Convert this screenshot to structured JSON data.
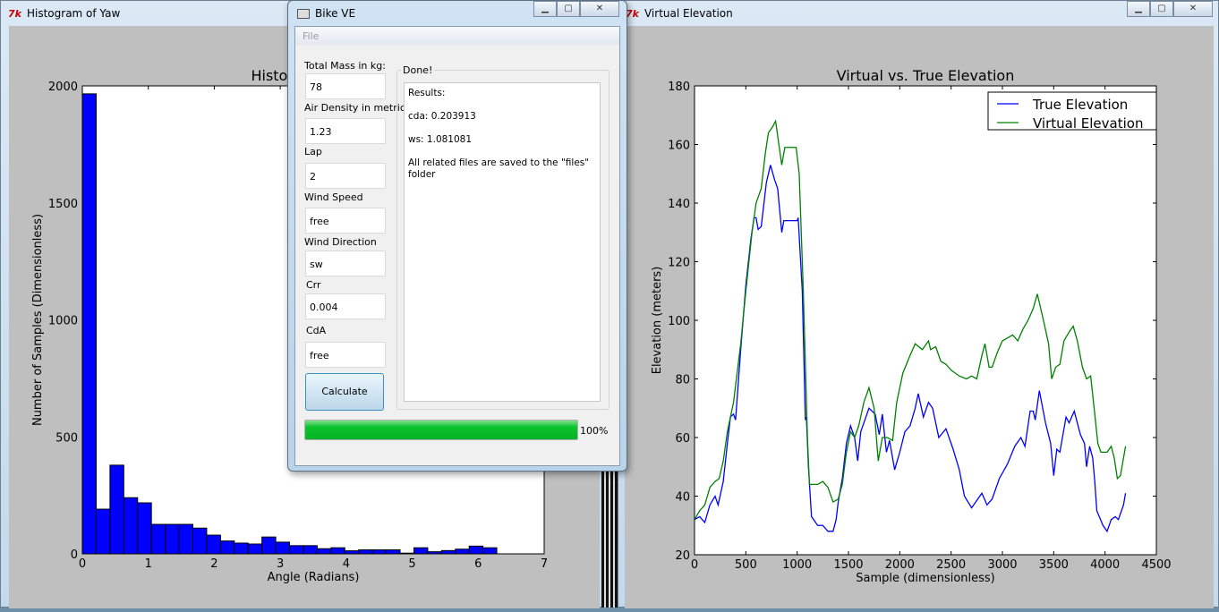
{
  "histogram_window": {
    "title": "Histogram of Yaw"
  },
  "elevation_window": {
    "title": "Virtual Elevation"
  },
  "dialog": {
    "title": "Bike VE",
    "menu_file": "File",
    "fields": [
      {
        "label": "Total Mass in kg:",
        "value": "78"
      },
      {
        "label": "Air Density in metric",
        "value": "1.23"
      },
      {
        "label": "Lap",
        "value": "2"
      },
      {
        "label": "Wind Speed",
        "value": "free"
      },
      {
        "label": "Wind Direction",
        "value": "sw"
      },
      {
        "label": "Crr",
        "value": "0.004"
      },
      {
        "label": "CdA",
        "value": "free"
      }
    ],
    "group_title": "Done!",
    "results": {
      "heading": "Results:",
      "cda": "cda: 0.203913",
      "ws": "ws: 1.081081",
      "note": "All related files are saved to the \"files\" folder"
    },
    "calculate_label": "Calculate",
    "progress": 100,
    "progress_label": "100%",
    "progress_color": "#06b425"
  },
  "chart_data": [
    {
      "type": "bar",
      "title": "Histogram of Yaw",
      "xlabel": "Angle (Radians)",
      "ylabel": "Number of Samples (Dimensionless)",
      "xlim": [
        0,
        7
      ],
      "ylim": [
        0,
        2000
      ],
      "xticks": [
        "0",
        "1",
        "2",
        "3",
        "4",
        "5",
        "6",
        "7"
      ],
      "yticks": [
        "0",
        "500",
        "1000",
        "1500",
        "2000"
      ],
      "bin_start": 0,
      "bin_width": 0.2094,
      "color": "#0000ff",
      "values": [
        1966,
        191,
        379,
        240,
        218,
        126,
        126,
        126,
        110,
        80,
        55,
        46,
        42,
        72,
        50,
        35,
        35,
        22,
        26,
        13,
        17,
        17,
        17,
        3,
        26,
        9,
        14,
        20,
        33,
        26
      ]
    },
    {
      "type": "line",
      "title": "Virtual vs. True Elevation",
      "xlabel": "Sample (dimensionless)",
      "ylabel": "Elevation (meters)",
      "xlim": [
        0,
        4500
      ],
      "ylim": [
        20,
        180
      ],
      "xticks": [
        "0",
        "500",
        "1000",
        "1500",
        "2000",
        "2500",
        "3000",
        "3500",
        "4000",
        "4500"
      ],
      "yticks": [
        "20",
        "40",
        "60",
        "80",
        "100",
        "120",
        "140",
        "160",
        "180"
      ],
      "legend": "top-right",
      "series": [
        {
          "name": "True Elevation",
          "color": "#0000ff",
          "points": [
            [
              0,
              32
            ],
            [
              50,
              33
            ],
            [
              100,
              31
            ],
            [
              150,
              37
            ],
            [
              200,
              40
            ],
            [
              230,
              37
            ],
            [
              280,
              45
            ],
            [
              320,
              58
            ],
            [
              350,
              67
            ],
            [
              380,
              68
            ],
            [
              400,
              66
            ],
            [
              450,
              90
            ],
            [
              500,
              112
            ],
            [
              550,
              128
            ],
            [
              580,
              135
            ],
            [
              600,
              135
            ],
            [
              620,
              131
            ],
            [
              650,
              132
            ],
            [
              700,
              147
            ],
            [
              740,
              153
            ],
            [
              780,
              148
            ],
            [
              810,
              145
            ],
            [
              850,
              130
            ],
            [
              870,
              134
            ],
            [
              1000,
              134
            ],
            [
              1010,
              135
            ],
            [
              1050,
              110
            ],
            [
              1080,
              66
            ],
            [
              1090,
              67
            ],
            [
              1110,
              50
            ],
            [
              1140,
              33
            ],
            [
              1200,
              30
            ],
            [
              1250,
              30
            ],
            [
              1300,
              28
            ],
            [
              1350,
              28
            ],
            [
              1380,
              32
            ],
            [
              1400,
              38
            ],
            [
              1440,
              46
            ],
            [
              1480,
              58
            ],
            [
              1520,
              64
            ],
            [
              1560,
              60
            ],
            [
              1590,
              52
            ],
            [
              1620,
              62
            ],
            [
              1700,
              70
            ],
            [
              1760,
              68
            ],
            [
              1800,
              61
            ],
            [
              1830,
              68
            ],
            [
              1870,
              55
            ],
            [
              1900,
              59
            ],
            [
              1950,
              49
            ],
            [
              2000,
              55
            ],
            [
              2050,
              62
            ],
            [
              2100,
              64
            ],
            [
              2150,
              70
            ],
            [
              2180,
              75
            ],
            [
              2230,
              67
            ],
            [
              2280,
              72
            ],
            [
              2320,
              70
            ],
            [
              2380,
              60
            ],
            [
              2450,
              63
            ],
            [
              2520,
              56
            ],
            [
              2580,
              49
            ],
            [
              2630,
              40
            ],
            [
              2700,
              36
            ],
            [
              2760,
              39
            ],
            [
              2800,
              41
            ],
            [
              2850,
              37
            ],
            [
              2900,
              39
            ],
            [
              2970,
              46
            ],
            [
              3050,
              51
            ],
            [
              3120,
              57
            ],
            [
              3180,
              60
            ],
            [
              3220,
              57
            ],
            [
              3270,
              69
            ],
            [
              3300,
              69
            ],
            [
              3320,
              66
            ],
            [
              3360,
              76
            ],
            [
              3420,
              65
            ],
            [
              3470,
              58
            ],
            [
              3500,
              47
            ],
            [
              3530,
              56
            ],
            [
              3560,
              55
            ],
            [
              3620,
              67
            ],
            [
              3650,
              65
            ],
            [
              3700,
              69
            ],
            [
              3760,
              61
            ],
            [
              3800,
              58
            ],
            [
              3820,
              50
            ],
            [
              3850,
              57
            ],
            [
              3880,
              53
            ],
            [
              3900,
              45
            ],
            [
              3920,
              35
            ],
            [
              3980,
              30
            ],
            [
              4020,
              28
            ],
            [
              4060,
              32
            ],
            [
              4100,
              33
            ],
            [
              4130,
              32
            ],
            [
              4180,
              37
            ],
            [
              4200,
              41
            ]
          ]
        },
        {
          "name": "Virtual Elevation",
          "color": "#008000",
          "points": [
            [
              0,
              32
            ],
            [
              50,
              35
            ],
            [
              100,
              37
            ],
            [
              150,
              43
            ],
            [
              200,
              45
            ],
            [
              240,
              46
            ],
            [
              280,
              52
            ],
            [
              320,
              62
            ],
            [
              380,
              72
            ],
            [
              450,
              92
            ],
            [
              500,
              110
            ],
            [
              560,
              130
            ],
            [
              600,
              140
            ],
            [
              650,
              145
            ],
            [
              690,
              157
            ],
            [
              720,
              164
            ],
            [
              760,
              166
            ],
            [
              790,
              168
            ],
            [
              830,
              158
            ],
            [
              850,
              153
            ],
            [
              880,
              159
            ],
            [
              990,
              159
            ],
            [
              1020,
              150
            ],
            [
              1060,
              110
            ],
            [
              1100,
              60
            ],
            [
              1120,
              44
            ],
            [
              1200,
              44
            ],
            [
              1250,
              45
            ],
            [
              1300,
              43
            ],
            [
              1350,
              38
            ],
            [
              1400,
              39
            ],
            [
              1440,
              44
            ],
            [
              1480,
              55
            ],
            [
              1520,
              62
            ],
            [
              1560,
              60
            ],
            [
              1600,
              64
            ],
            [
              1650,
              72
            ],
            [
              1700,
              77
            ],
            [
              1750,
              70
            ],
            [
              1790,
              52
            ],
            [
              1830,
              60
            ],
            [
              1880,
              60
            ],
            [
              1930,
              59
            ],
            [
              1970,
              72
            ],
            [
              2030,
              82
            ],
            [
              2100,
              88
            ],
            [
              2150,
              92
            ],
            [
              2220,
              90
            ],
            [
              2280,
              93
            ],
            [
              2300,
              90
            ],
            [
              2350,
              91
            ],
            [
              2400,
              86
            ],
            [
              2450,
              85
            ],
            [
              2500,
              83
            ],
            [
              2580,
              81
            ],
            [
              2650,
              80
            ],
            [
              2700,
              81
            ],
            [
              2750,
              80
            ],
            [
              2800,
              88
            ],
            [
              2830,
              92
            ],
            [
              2870,
              84
            ],
            [
              2900,
              84
            ],
            [
              2950,
              89
            ],
            [
              3000,
              93
            ],
            [
              3050,
              94
            ],
            [
              3100,
              95
            ],
            [
              3150,
              93
            ],
            [
              3200,
              97
            ],
            [
              3250,
              100
            ],
            [
              3300,
              104
            ],
            [
              3340,
              109
            ],
            [
              3400,
              100
            ],
            [
              3450,
              92
            ],
            [
              3480,
              80
            ],
            [
              3520,
              84
            ],
            [
              3560,
              85
            ],
            [
              3600,
              93
            ],
            [
              3650,
              96
            ],
            [
              3690,
              98
            ],
            [
              3730,
              93
            ],
            [
              3780,
              84
            ],
            [
              3820,
              80
            ],
            [
              3860,
              81
            ],
            [
              3900,
              68
            ],
            [
              3930,
              58
            ],
            [
              3960,
              55
            ],
            [
              4020,
              55
            ],
            [
              4060,
              57
            ],
            [
              4090,
              53
            ],
            [
              4120,
              46
            ],
            [
              4150,
              47
            ],
            [
              4200,
              57
            ]
          ]
        }
      ]
    }
  ]
}
